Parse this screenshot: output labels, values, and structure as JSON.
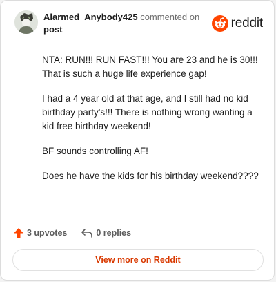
{
  "comment": {
    "username": "Alarmed_Anybody425",
    "action_text": "commented on",
    "post_link": "post",
    "paragraphs": [
      "NTA: RUN!!! RUN FAST!!! You are 23 and he is 30!!! That is such a huge life experience gap!",
      "I had a 4 year old at that age, and I still had no kid birthday party's!!! There is nothing wrong wanting a kid free birthday weekend!",
      "BF sounds controlling AF!",
      "Does he have the kids for his birthday weekend????"
    ]
  },
  "brand": {
    "wordmark": "reddit",
    "color": "#ff4500"
  },
  "actions": {
    "upvotes": "3 upvotes",
    "replies": "0 replies",
    "upvote_color": "#ff4500"
  },
  "footer": {
    "view_more": "View more on Reddit",
    "link_color": "#d93900"
  }
}
